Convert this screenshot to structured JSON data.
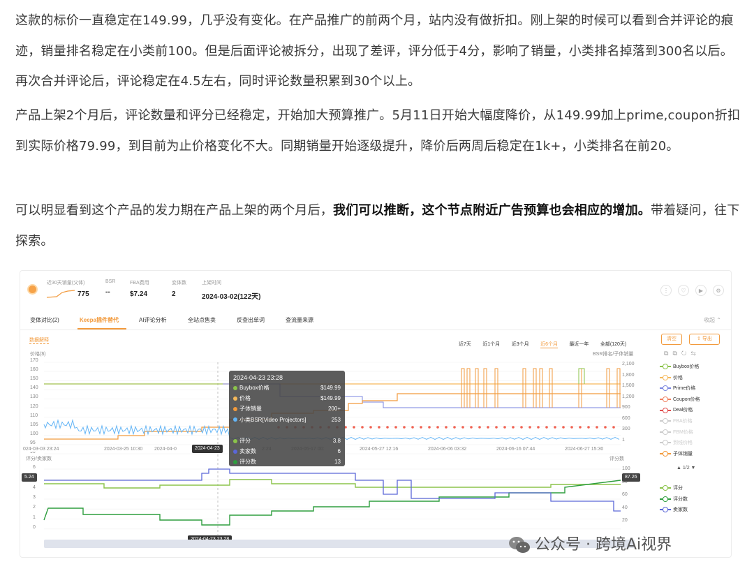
{
  "article": {
    "p1": "这款的标价一直稳定在149.99，几乎没有变化。在产品推广的前两个月，站内没有做折扣。刚上架的时候可以看到合并评论的痕迹，销量排名稳定在小类前100。但是后面评论被拆分，出现了差评，评分低于4分，影响了销量，小类排名掉落到300名以后。再次合并评论后，评论稳定在4.5左右，同时评论数量积累到30个以上。",
    "p2": "产品上架2个月后，评论数量和评分已经稳定，开始加大预算推广。5月11日开始大幅度降价，从149.99加上prime,coupon折扣到实际价格79.99，到目前为止价格变化不大。同期销量开始逐级提升，降价后两周后稳定在1k+，小类排名在前20。",
    "p3_normal": "可以明显看到这个产品的发力期在产品上架的两个月后，",
    "p3_bold": "我们可以推断，这个节点附近广告预算也会相应的增加。",
    "p3_tail": "带着疑问，往下探索。"
  },
  "panel": {
    "stats": [
      {
        "key": "近30天销量(父体)",
        "value": "775"
      },
      {
        "key": "BSR",
        "value": "--"
      },
      {
        "key": "FBA费用",
        "value": "$7.24"
      },
      {
        "key": "变体数",
        "value": "2"
      },
      {
        "key": "上架时间",
        "value": "2024-03-02(122天)"
      }
    ],
    "tabs": [
      "变体对比(2)",
      "Keepa插件替代",
      "AI评论分析",
      "全站点售卖",
      "反查出单词",
      "查流量来源"
    ],
    "collapse": "收起",
    "data_explain": "数据解释",
    "ranges": [
      "近7天",
      "近1个月",
      "近3个月",
      "近6个月",
      "最近一年",
      "全部(120天)"
    ],
    "btn_clear": "清空",
    "btn_export": "导出",
    "legend_upper": [
      {
        "name": "Buybox价格",
        "color": "#8bc34a",
        "on": true
      },
      {
        "name": "价格",
        "color": "#f5b85a",
        "on": true
      },
      {
        "name": "Prime价格",
        "color": "#7a86e0",
        "on": true
      },
      {
        "name": "Coupon价格",
        "color": "#f08060",
        "on": true
      },
      {
        "name": "Deal价格",
        "color": "#e05050",
        "on": true
      },
      {
        "name": "FBA价格",
        "color": "#cccccc",
        "on": false
      },
      {
        "name": "FBM价格",
        "color": "#cccccc",
        "on": false
      },
      {
        "name": "到线价格",
        "color": "#cccccc",
        "on": false
      },
      {
        "name": "子体销量",
        "color": "#f29a3c",
        "on": true
      }
    ],
    "legend_page": "▲ 1/2 ▼",
    "legend_lower": [
      {
        "name": "评分",
        "color": "#8bc34a"
      },
      {
        "name": "评分数",
        "color": "#2e9e3e"
      },
      {
        "name": "卖家数",
        "color": "#5b67d8"
      }
    ],
    "upper_y_title": "价格($)",
    "upper_y2_title": "BSR排名/子体销量",
    "upper_y_ticks": [
      "170",
      "160",
      "150",
      "140",
      "130",
      "120",
      "110",
      "105",
      "100",
      "95",
      "90"
    ],
    "upper_y2_ticks": [
      "2,100",
      "1,800",
      "1,500",
      "1,200",
      "900",
      "600",
      "300",
      "1"
    ],
    "x_ticks": [
      "024-03-03 23:24",
      "2024-03-25 10:30",
      "2024-04-0",
      "2024-05-17 00:",
      "2024-05-27 12:16",
      "2024-06-06 03:32",
      "2024-06-16 07:44",
      "2024-06-27 15:30"
    ],
    "x_ticks_hidden": [
      "2024-04-",
      "2:24"
    ],
    "cursor_pill_upper": "2024-04-23",
    "lower_y_title": "评分/卖家数",
    "lower_y2_title": "评分数",
    "lower_y_ticks": [
      "6",
      "5",
      "4",
      "3",
      "2",
      "1",
      "0"
    ],
    "lower_y2_ticks": [
      "100",
      "80",
      "60",
      "40",
      "20"
    ],
    "left_marker": "5.24",
    "right_marker": "87.26",
    "cursor_pill_lower": "2024-04-23 23:28",
    "tooltip": {
      "title": "2024-04-23 23:28",
      "rows": [
        {
          "label": "Buybox价格",
          "value": "$149.99",
          "color": "#8bc34a"
        },
        {
          "label": "价格",
          "value": "$149.99",
          "color": "#f5b85a"
        },
        {
          "label": "子体销量",
          "value": "200+",
          "color": "#f29a3c"
        },
        {
          "label": "小类BSR[Video Projectors]",
          "value": "253",
          "color": "#64b5f6"
        },
        {
          "label": "",
          "value": "",
          "color": "transparent"
        },
        {
          "label": "评分",
          "value": "3.8",
          "color": "#8bc34a"
        },
        {
          "label": "卖家数",
          "value": "6",
          "color": "#5b67d8"
        },
        {
          "label": "评分数",
          "value": "13",
          "color": "#2e9e3e"
        }
      ]
    }
  },
  "watermark": {
    "text": "公众号 · 跨境Ai视界"
  }
}
